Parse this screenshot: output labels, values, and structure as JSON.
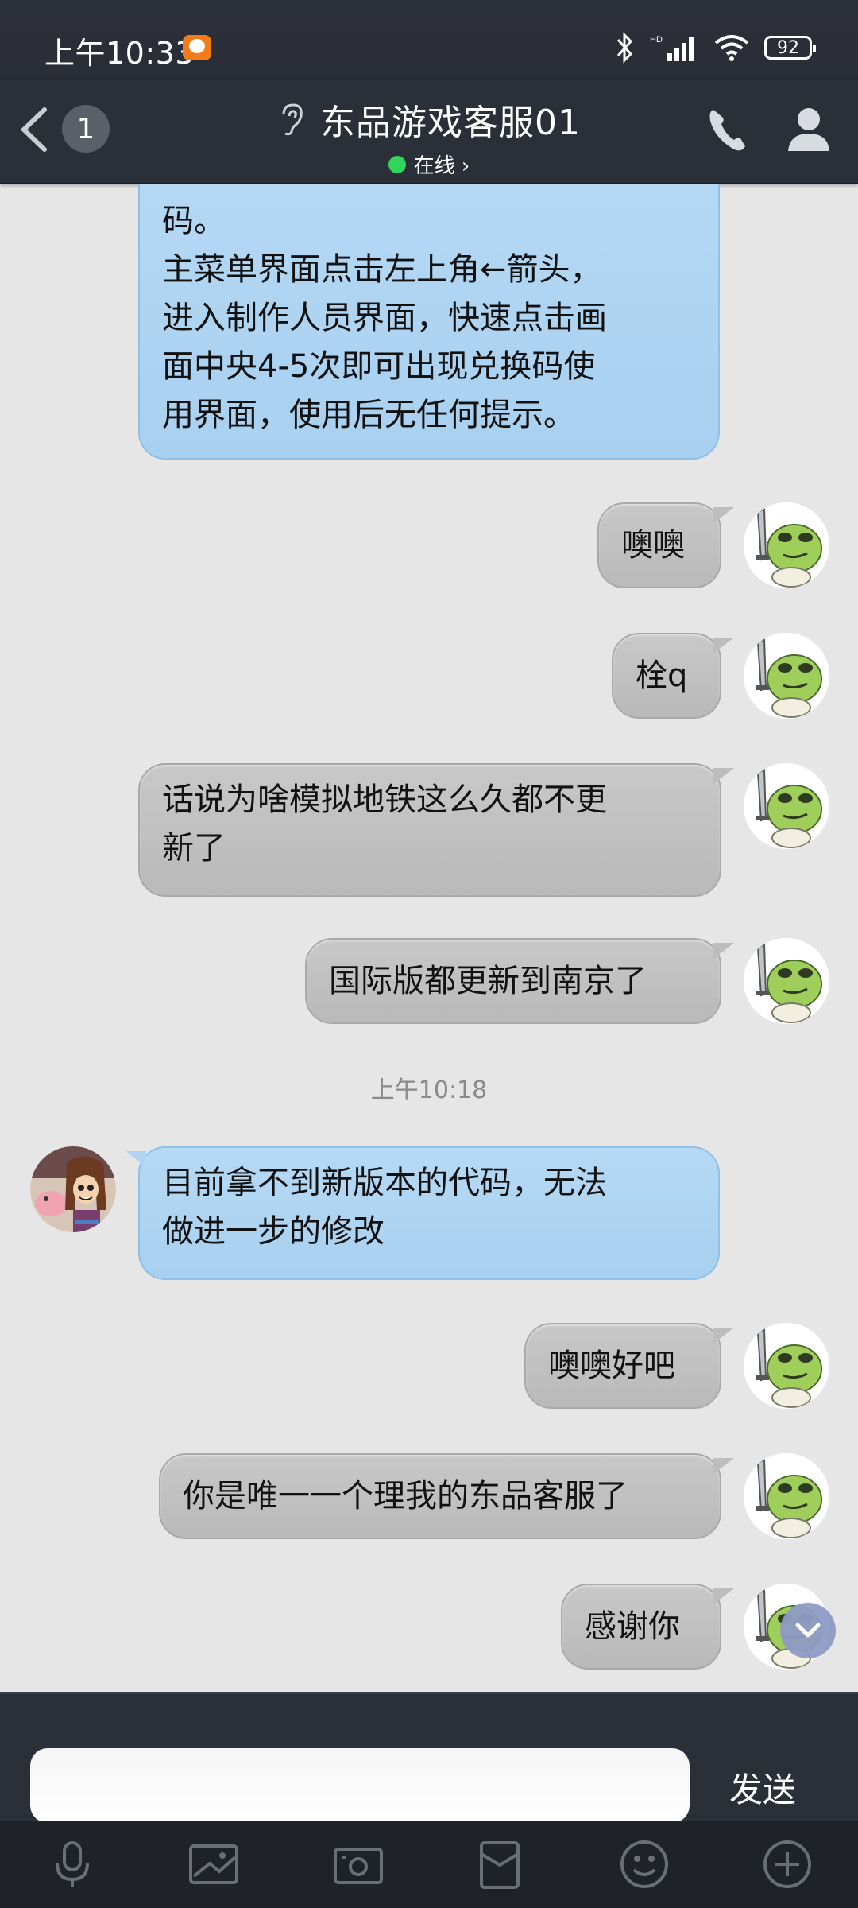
{
  "status": {
    "time": "上午10:33",
    "battery": "92"
  },
  "header": {
    "back_count": "1",
    "title": "东品游戏客服01",
    "online": "在线 ›"
  },
  "messages": {
    "m1": "码。\n主菜单界面点击左上角←箭头，\n进入制作人员界面，快速点击画\n面中央4-5次即可出现兑换码使\n用界面，使用后无任何提示。",
    "m2": "噢噢",
    "m3": "栓q",
    "m4": "话说为啥模拟地铁这么久都不更\n新了",
    "m5": "国际版都更新到南京了",
    "ts": "上午10:18",
    "m6": "目前拿不到新版本的代码，无法\n做进一步的修改",
    "m7": "噢噢好吧",
    "m8": "你是唯一一个理我的东品客服了",
    "m9": "感谢你"
  },
  "input": {
    "placeholder": "",
    "send_label": "发送"
  },
  "icons": [
    "back-icon",
    "ear-icon",
    "phone-icon",
    "person-icon",
    "mic-icon",
    "image-icon",
    "camera-icon",
    "red-packet-icon",
    "emoji-icon",
    "plus-icon",
    "chevron-down-icon"
  ],
  "colors": {
    "header_bg": "#2b2f38",
    "blue_bubble": "#b0d4f2",
    "gray_bubble": "#c0c0c0",
    "online": "#30d65a"
  }
}
